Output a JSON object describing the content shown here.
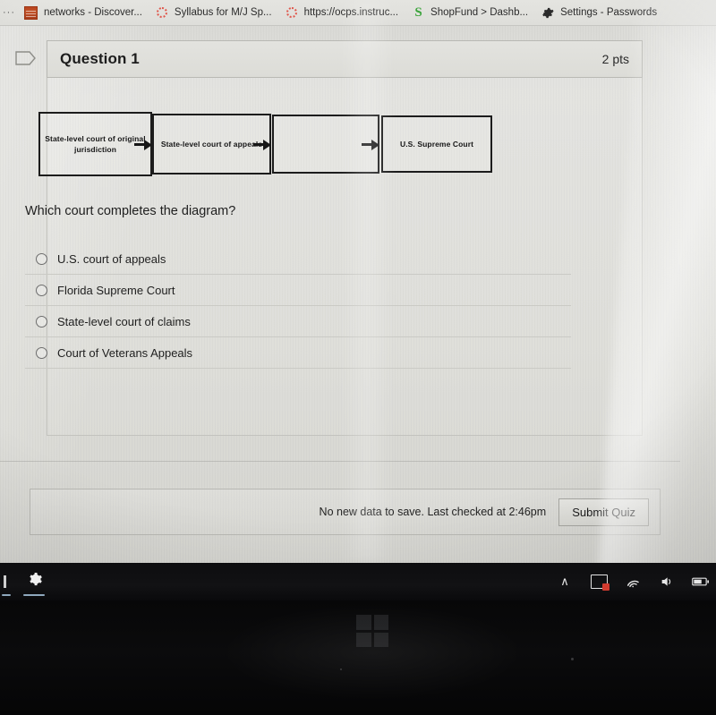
{
  "browser": {
    "overflow_indicator": "···",
    "tabs": [
      {
        "label": "networks - Discover...",
        "icon": "networks-favicon"
      },
      {
        "label": "Syllabus for M/J Sp...",
        "icon": "loading-spinner-icon"
      },
      {
        "label": "https://ocps.instruc...",
        "icon": "loading-spinner-icon"
      },
      {
        "label": "ShopFund > Dashb...",
        "icon": "shopfund-s-icon"
      },
      {
        "label": "Settings - Passwords",
        "icon": "gear-icon"
      }
    ]
  },
  "question": {
    "flag_icon": "flag-question-icon",
    "title": "Question 1",
    "points": "2 pts",
    "prompt": "Which court completes the diagram?",
    "diagram": {
      "boxes": [
        {
          "text": "State-level court of original jurisdiction"
        },
        {
          "text": "State-level court of appeals"
        },
        {
          "text": ""
        },
        {
          "text": "U.S. Supreme Court"
        }
      ],
      "arrow_icon": "right-arrow-icon"
    },
    "answers": [
      {
        "label": "U.S. court of appeals",
        "selected": false
      },
      {
        "label": "Florida Supreme Court",
        "selected": false
      },
      {
        "label": "State-level court of claims",
        "selected": false
      },
      {
        "label": "Court of Veterans Appeals",
        "selected": false
      }
    ]
  },
  "footer": {
    "save_status": "No new data to save. Last checked at 2:46pm",
    "submit_label": "Submit Quiz"
  },
  "taskbar": {
    "items": [
      {
        "icon": "edge-bar-icon"
      },
      {
        "icon": "gear-icon"
      }
    ],
    "tray": [
      {
        "icon": "chevron-up-icon",
        "glyph": "∧"
      },
      {
        "icon": "notification-badge-icon",
        "glyph": ""
      },
      {
        "icon": "wifi-icon",
        "glyph": ""
      },
      {
        "icon": "volume-icon",
        "glyph": ""
      },
      {
        "icon": "battery-icon",
        "glyph": ""
      }
    ]
  },
  "bezel": {
    "reflection_icon": "windows-logo-reflection"
  },
  "colors": {
    "screen_bg": "#dcdcd7",
    "card_border": "#b9b9b4",
    "text": "#1f1f1f",
    "taskbar_bg": "#0d0d0f",
    "badge_red": "#d23b2f",
    "shopfund_green": "#3aa33a"
  }
}
